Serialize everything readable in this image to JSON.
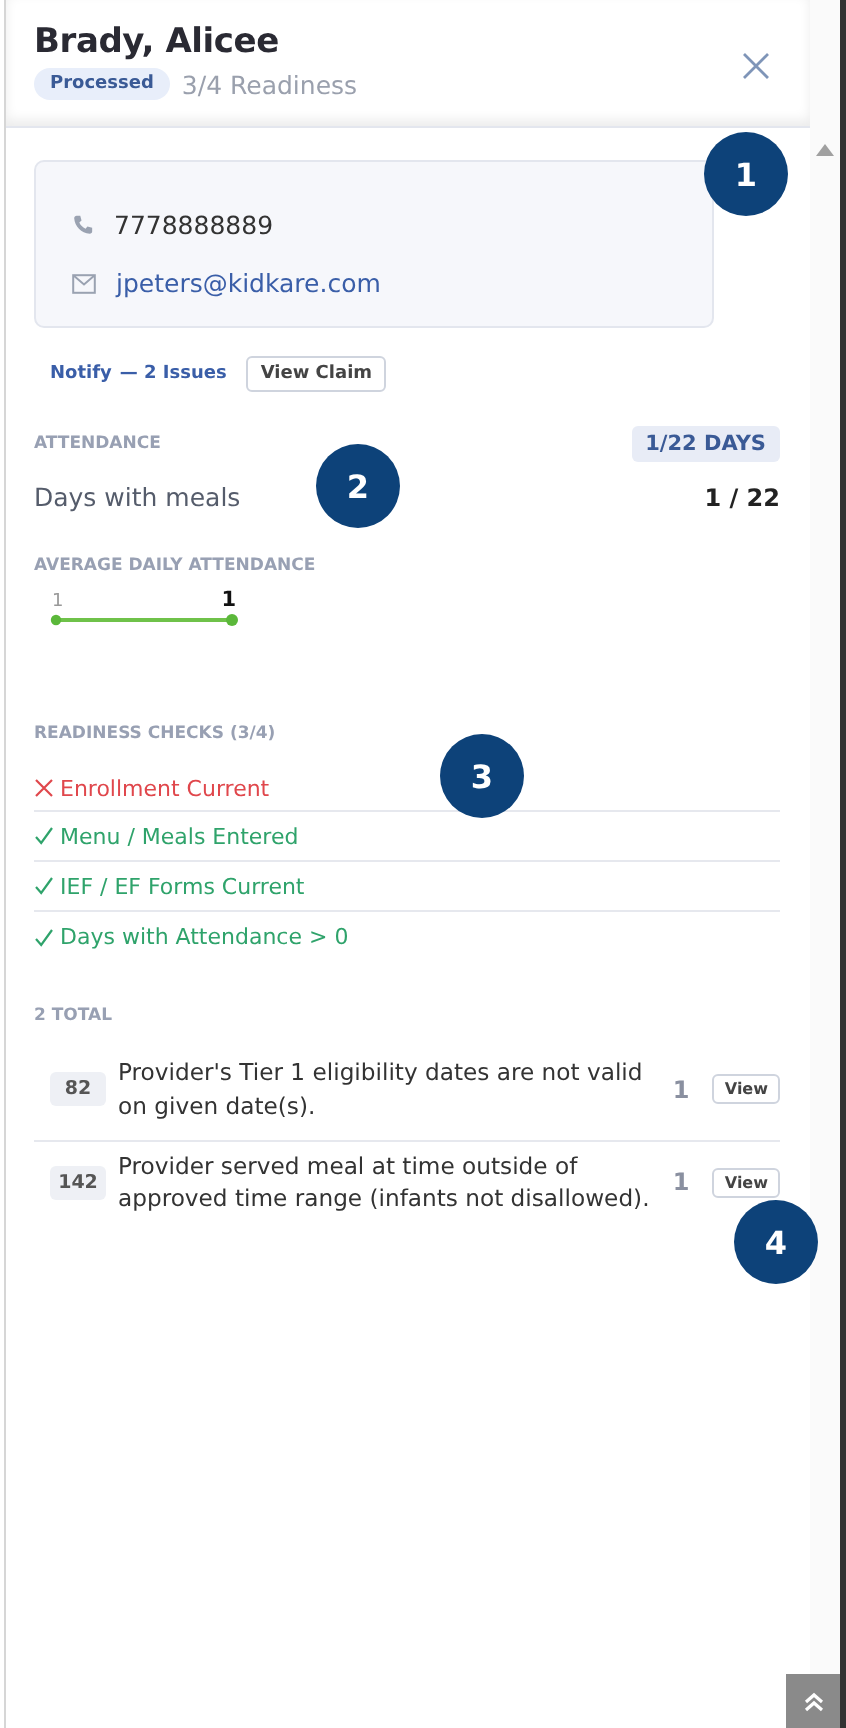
{
  "header": {
    "title": "Brady, Alicee",
    "status_badge": "Processed",
    "readiness": "3/4 Readiness"
  },
  "contact": {
    "phone": "7778888889",
    "email": "jpeters@kidkare.com"
  },
  "actions": {
    "notify": "Notify",
    "issues": "— 2 Issues",
    "view_claim": "View Claim"
  },
  "attendance": {
    "heading": "ATTENDANCE",
    "days_badge": "1/22 DAYS",
    "label": "Days with meals",
    "value": "1 / 22"
  },
  "average": {
    "heading": "AVERAGE DAILY ATTENDANCE",
    "start_label": "1",
    "end_label": "1"
  },
  "readiness_checks": {
    "heading": "READINESS CHECKS (3/4)",
    "items": [
      {
        "label": "Enrollment Current",
        "passed": false
      },
      {
        "label": "Menu / Meals Entered",
        "passed": true
      },
      {
        "label": "IEF / EF Forms Current",
        "passed": true
      },
      {
        "label": "Days with Attendance > 0",
        "passed": true
      }
    ]
  },
  "issues": {
    "heading": "2 TOTAL",
    "rows": [
      {
        "code": "82",
        "message": "Provider's Tier 1 eligibility dates are not valid on given date(s).",
        "count": "1",
        "action": "View"
      },
      {
        "code": "142",
        "message": "Provider served meal at time outside of approved time range (infants not disallowed).",
        "count": "1",
        "action": "View"
      }
    ]
  },
  "callouts": [
    "1",
    "2",
    "3",
    "4"
  ]
}
